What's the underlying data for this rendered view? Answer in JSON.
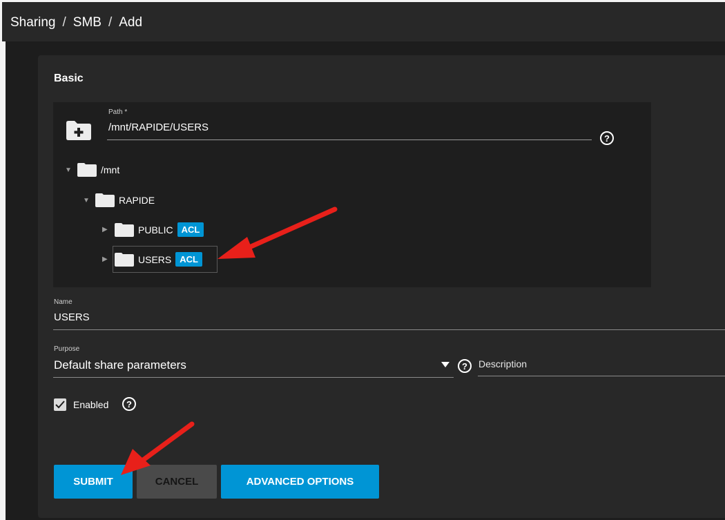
{
  "breadcrumb": {
    "part1": "Sharing",
    "part2": "SMB",
    "part3": "Add",
    "sep": "/"
  },
  "section": {
    "title": "Basic"
  },
  "path": {
    "label": "Path *",
    "value": "/mnt/RAPIDE/USERS",
    "help_icon": "help-circle-icon"
  },
  "tree": {
    "root": "/mnt",
    "pool": "RAPIDE",
    "children": [
      {
        "label": "PUBLIC",
        "badge": "ACL"
      },
      {
        "label": "USERS",
        "badge": "ACL"
      }
    ]
  },
  "name_field": {
    "label": "Name",
    "value": "USERS"
  },
  "purpose_field": {
    "label": "Purpose",
    "value": "Default share parameters"
  },
  "description_field": {
    "placeholder": "Description"
  },
  "enabled": {
    "label": "Enabled",
    "checked": true
  },
  "buttons": {
    "submit": "SUBMIT",
    "cancel": "CANCEL",
    "advanced": "ADVANCED OPTIONS"
  },
  "colors": {
    "accent": "#0095d5",
    "background": "#1d1d1d",
    "card": "#282828",
    "annotation_arrow": "#e8201a"
  }
}
